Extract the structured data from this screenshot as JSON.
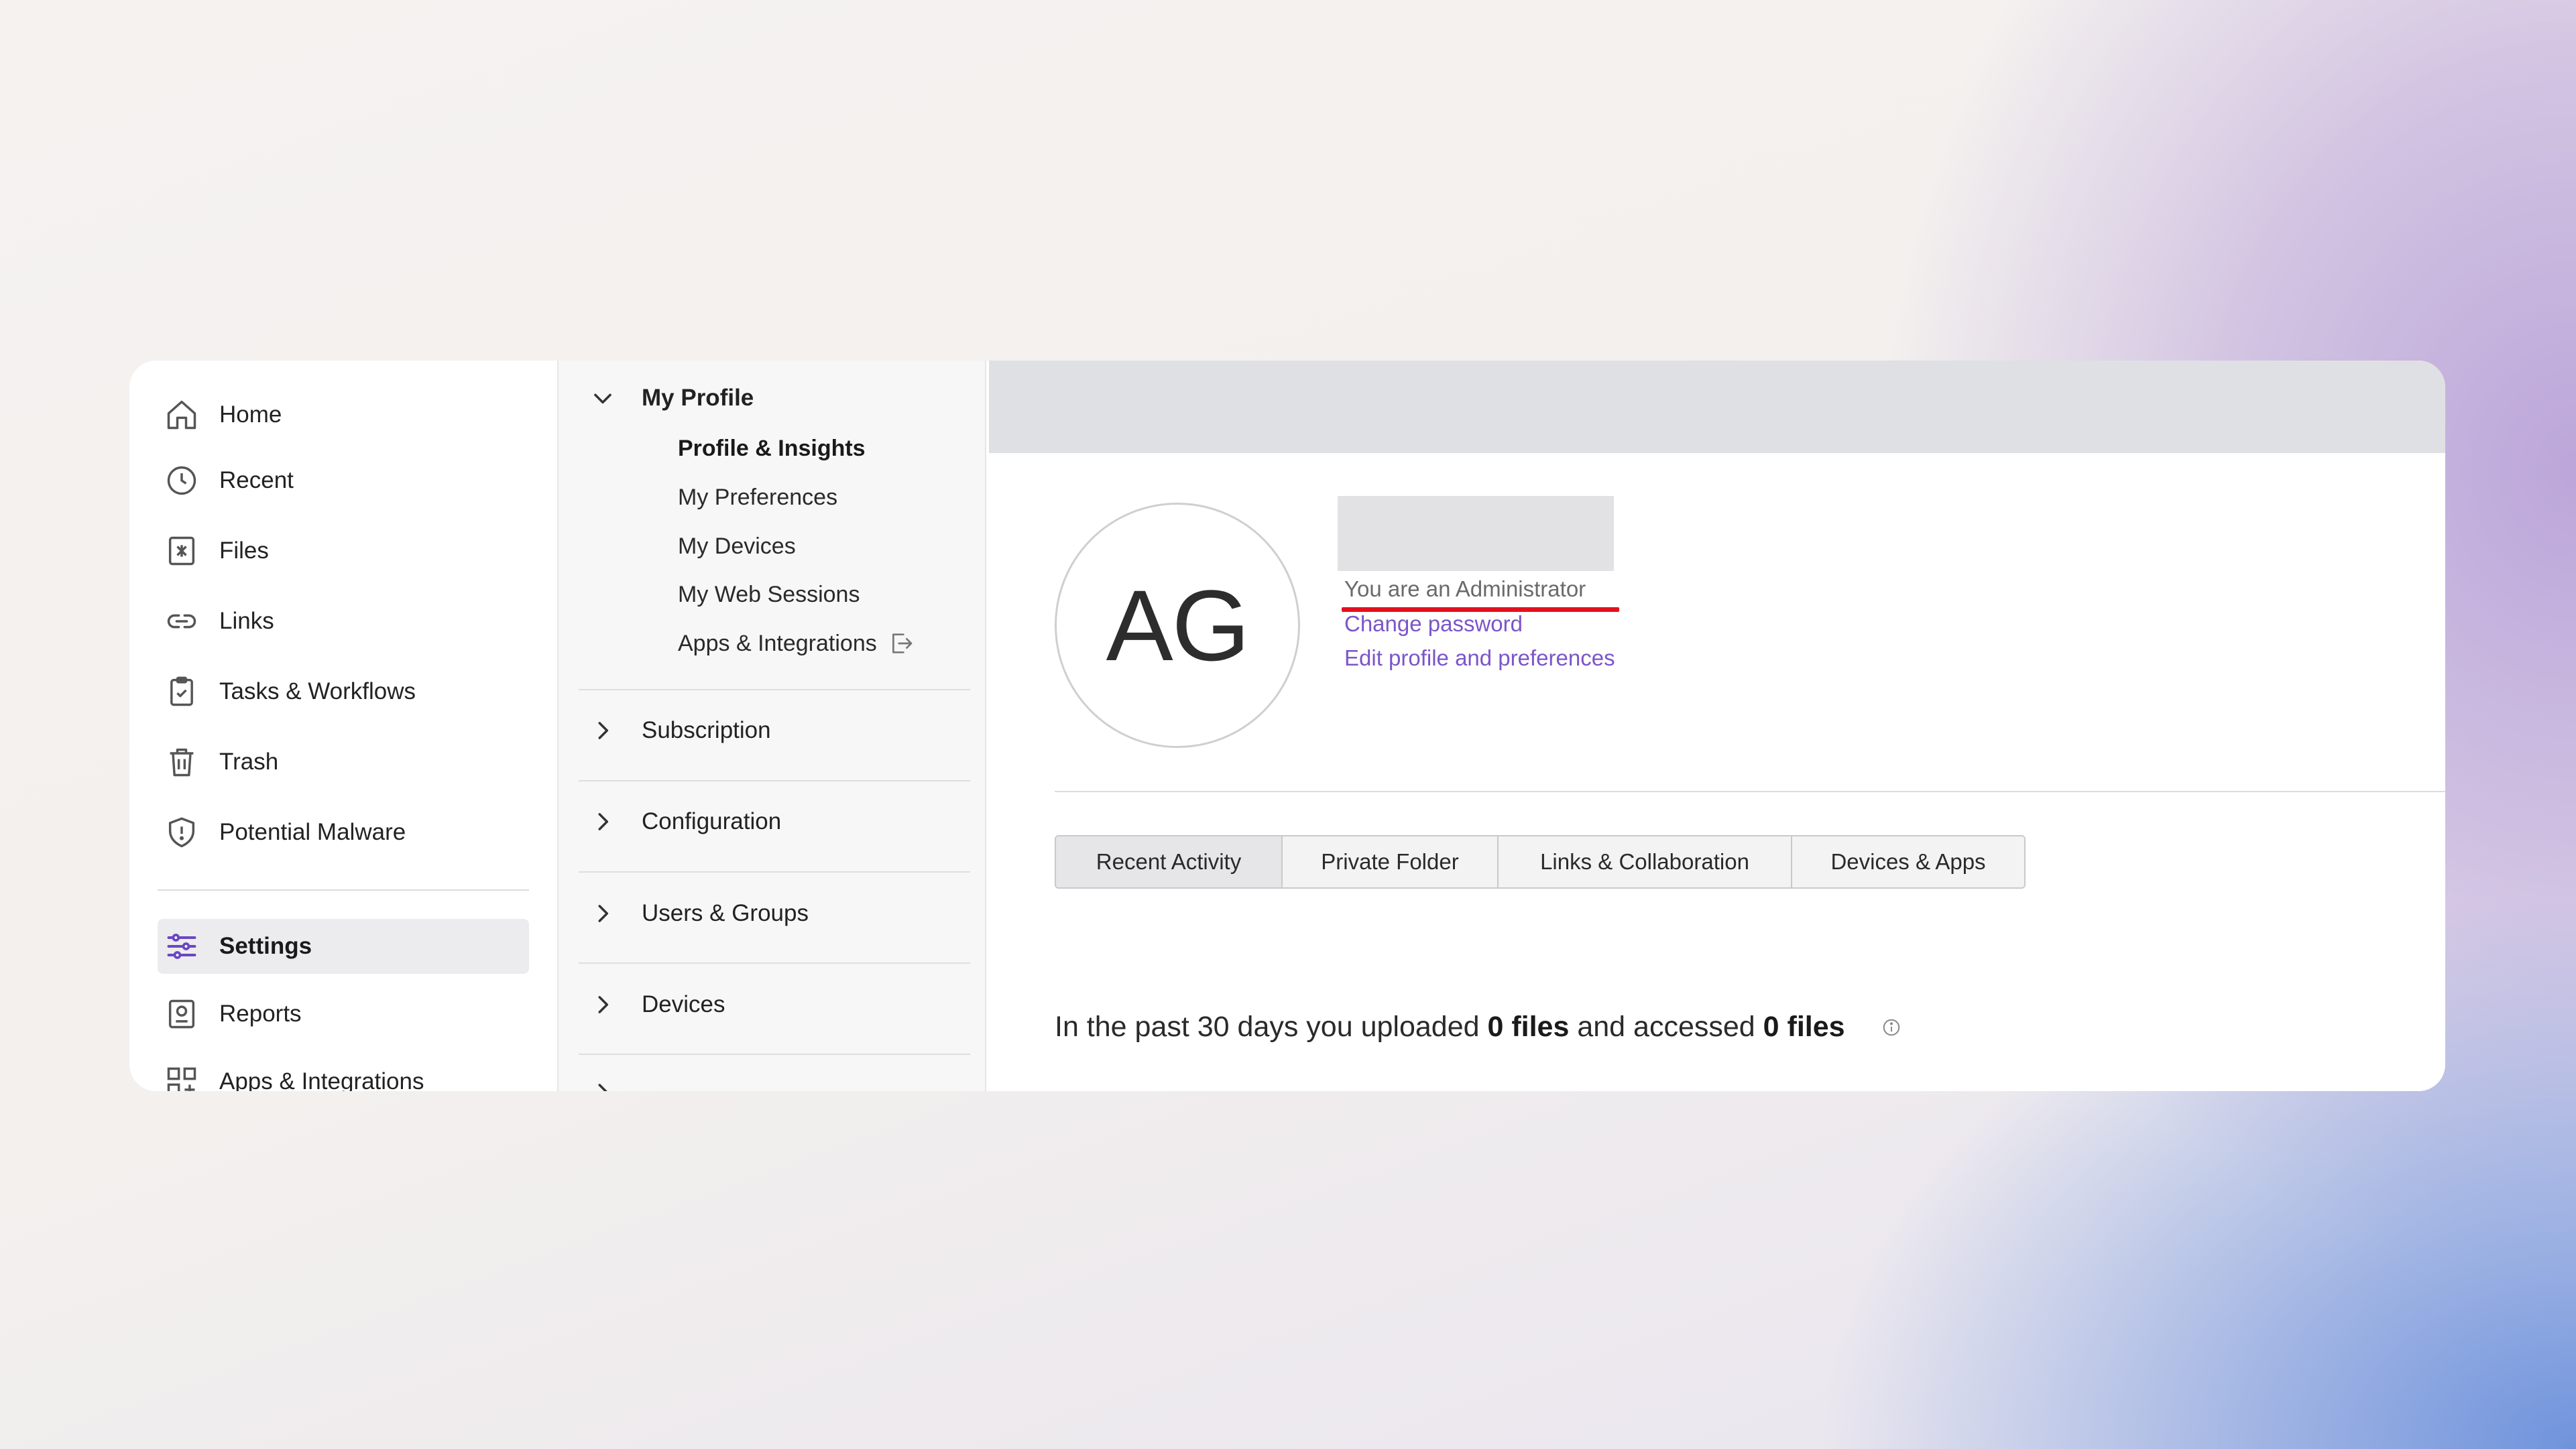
{
  "nav": {
    "items": [
      {
        "label": "Home",
        "icon": "home-icon"
      },
      {
        "label": "Recent",
        "icon": "clock-icon"
      },
      {
        "label": "Files",
        "icon": "files-icon"
      },
      {
        "label": "Links",
        "icon": "link-icon"
      },
      {
        "label": "Tasks & Workflows",
        "icon": "clipboard-check-icon"
      },
      {
        "label": "Trash",
        "icon": "trash-icon"
      },
      {
        "label": "Potential Malware",
        "icon": "shield-alert-icon"
      },
      {
        "label": "Settings",
        "icon": "sliders-icon",
        "active": true
      },
      {
        "label": "Reports",
        "icon": "report-icon"
      },
      {
        "label": "Apps & Integrations",
        "icon": "apps-icon"
      }
    ]
  },
  "settings_nav": {
    "my_profile": {
      "label": "My Profile",
      "items": [
        "Profile & Insights",
        "My Preferences",
        "My Devices",
        "My Web Sessions",
        "Apps & Integrations"
      ],
      "current": "Profile & Insights"
    },
    "sections": [
      "Subscription",
      "Configuration",
      "Users & Groups",
      "Devices"
    ]
  },
  "profile": {
    "initials": "AG",
    "role": "You are an Administrator",
    "change_password": "Change password",
    "edit_profile": "Edit profile and preferences"
  },
  "tabs": [
    "Recent Activity",
    "Private Folder",
    "Links & Collaboration",
    "Devices & Apps"
  ],
  "summary": {
    "prefix": "In the past 30 days you uploaded ",
    "uploaded": "0 files",
    "middle": " and accessed ",
    "accessed": "0 files"
  },
  "colors": {
    "accent": "#7b55c9",
    "highlight_underline": "#e4101e"
  }
}
